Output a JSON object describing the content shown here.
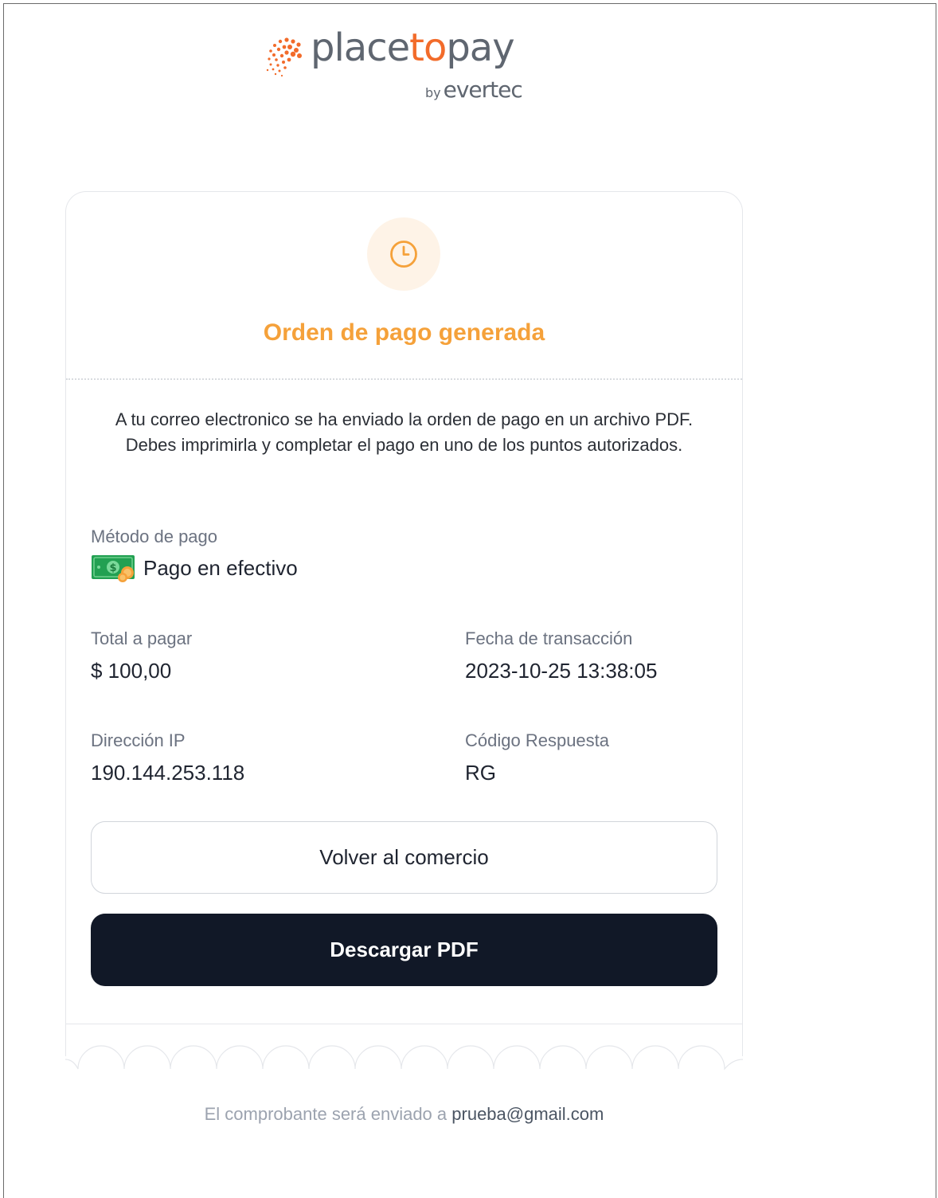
{
  "logo": {
    "brand_part1": "place",
    "brand_part2": "to",
    "brand_part3": "pay",
    "by": "by",
    "partner": "evertec"
  },
  "status": {
    "icon": "clock-icon",
    "title": "Orden de pago generada",
    "message": "A tu correo electronico se ha enviado la orden de pago en un archivo PDF. Debes imprimirla y completar el pago en uno de los puntos autorizados."
  },
  "payment_method": {
    "label": "Método de pago",
    "icon": "cash-icon",
    "value": "Pago en efectivo"
  },
  "details": {
    "total_label": "Total a pagar",
    "total_value": "$ 100,00",
    "date_label": "Fecha de transacción",
    "date_value": "2023-10-25 13:38:05",
    "ip_label": "Dirección IP",
    "ip_value": "190.144.253.118",
    "code_label": "Código Respuesta",
    "code_value": "RG"
  },
  "actions": {
    "back_label": "Volver al comercio",
    "download_label": "Descargar PDF"
  },
  "footer": {
    "text": "El comprobante será enviado a ",
    "email": "prueba@gmail.com"
  },
  "colors": {
    "accent": "#f5a13a",
    "brand_orange": "#f26b2a",
    "dark_button": "#111827",
    "status_bg": "#fef3e7"
  }
}
